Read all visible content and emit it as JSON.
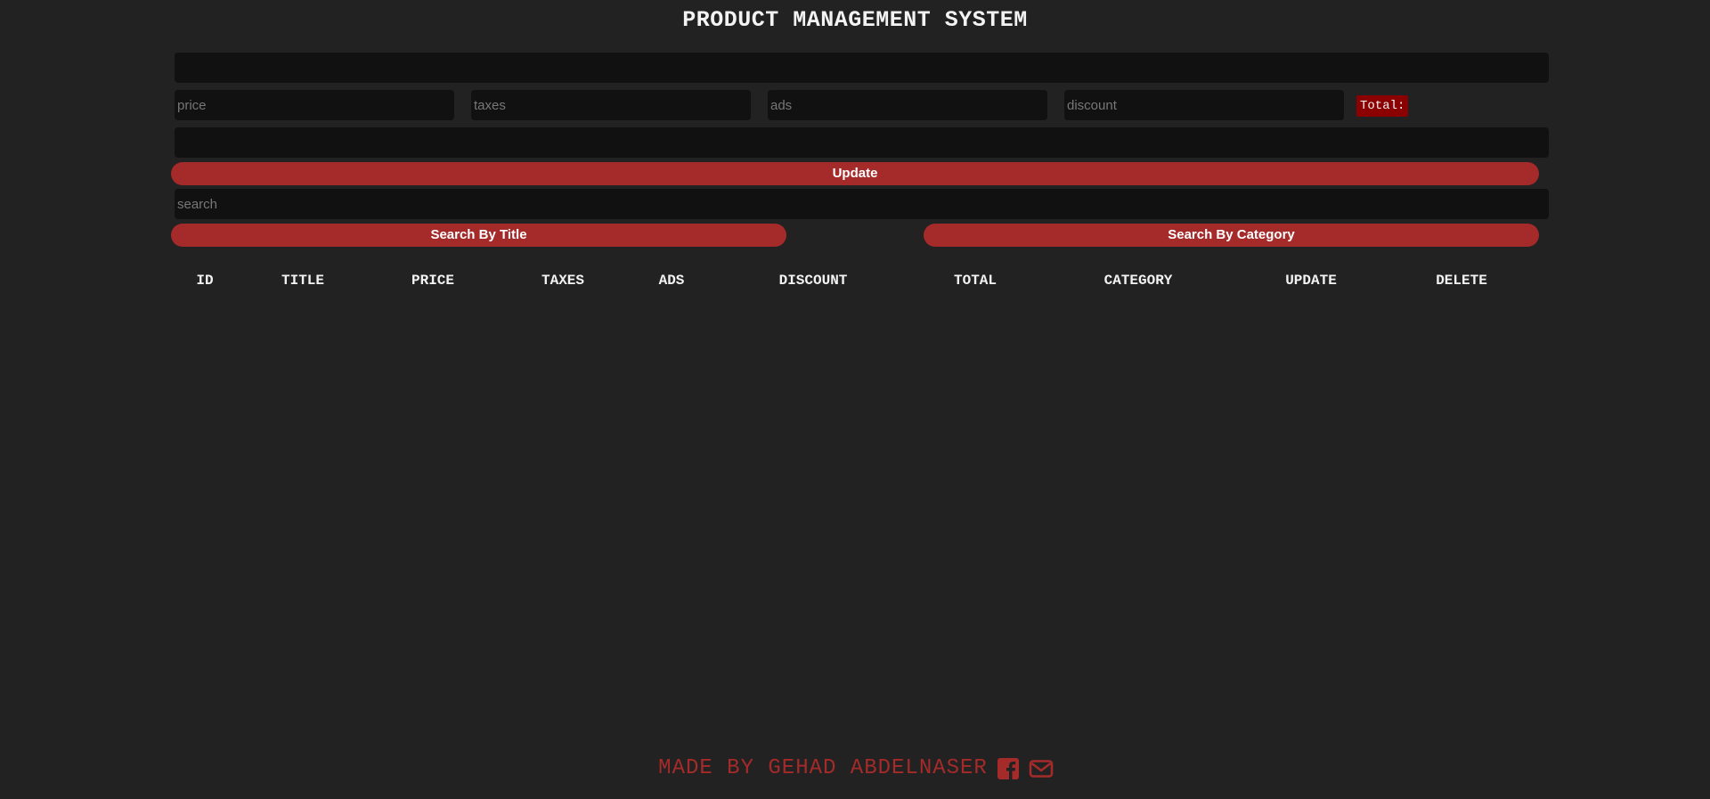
{
  "header": {
    "title": "PRODUCT MANAGEMENT SYSTEM"
  },
  "form": {
    "title_value": "",
    "price_placeholder": "price",
    "taxes_placeholder": "taxes",
    "ads_placeholder": "ads",
    "discount_placeholder": "discount",
    "total_label": "Total:",
    "count_value": "",
    "submit_label": "Update"
  },
  "search": {
    "placeholder": "search",
    "by_title_label": "Search By Title",
    "by_category_label": "Search By Category"
  },
  "table": {
    "columns": [
      "ID",
      "TITLE",
      "PRICE",
      "TAXES",
      "ADS",
      "DISCOUNT",
      "TOTAL",
      "CATEGORY",
      "UPDATE",
      "DELETE"
    ],
    "rows": []
  },
  "footer": {
    "text": "MADE BY GEHAD ABDELNASER",
    "icons": [
      "facebook-icon",
      "envelope-icon"
    ]
  },
  "colors": {
    "background": "#222222",
    "input": "#111111",
    "accent": "#a52a2a",
    "total_badge": "#8b0000",
    "text": "#f3f3f3"
  }
}
